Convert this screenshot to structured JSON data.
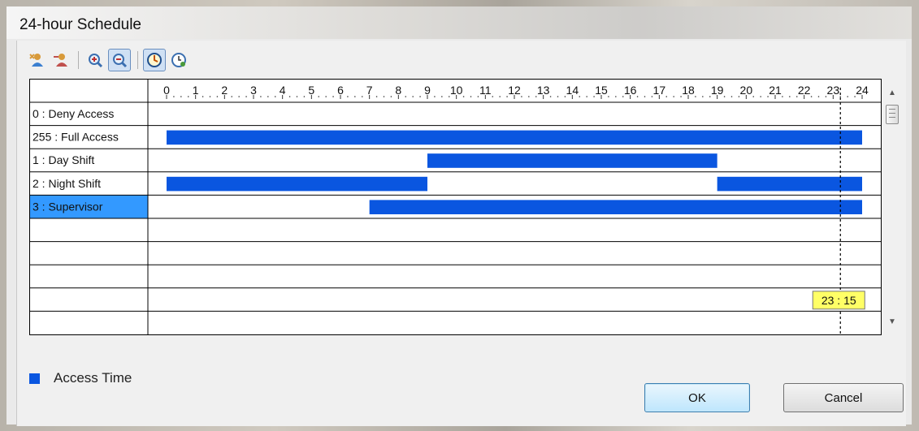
{
  "window": {
    "title": "24-hour Schedule"
  },
  "toolbar": {
    "buttons": [
      {
        "icon": "add-user-icon"
      },
      {
        "icon": "remove-user-icon"
      },
      {
        "icon": "zoom-in-icon"
      },
      {
        "icon": "zoom-out-icon",
        "active": true
      },
      {
        "icon": "clock-icon",
        "active": true
      },
      {
        "icon": "clock-settings-icon"
      }
    ]
  },
  "timeline": {
    "hours": [
      "0",
      "1",
      "2",
      "3",
      "4",
      "5",
      "6",
      "7",
      "8",
      "9",
      "10",
      "11",
      "12",
      "13",
      "14",
      "15",
      "16",
      "17",
      "18",
      "19",
      "20",
      "21",
      "22",
      "23",
      "24"
    ],
    "current_time_label": "23 : 15",
    "current_time_hours": 23.25
  },
  "rows": [
    {
      "label": "0 : Deny Access",
      "segments": []
    },
    {
      "label": "255 : Full Access",
      "segments": [
        [
          0,
          24
        ]
      ]
    },
    {
      "label": "1 : Day Shift",
      "segments": [
        [
          9,
          19
        ]
      ]
    },
    {
      "label": "2 : Night Shift",
      "segments": [
        [
          0,
          9
        ],
        [
          19,
          24
        ]
      ]
    },
    {
      "label": "3 : Supervisor",
      "segments": [
        [
          7,
          24
        ]
      ],
      "selected": true
    },
    {
      "label": "",
      "segments": []
    },
    {
      "label": "",
      "segments": []
    },
    {
      "label": "",
      "segments": []
    },
    {
      "label": "",
      "segments": []
    },
    {
      "label": "",
      "segments": []
    }
  ],
  "legend": {
    "label": "Access Time",
    "color": "#0a56e0"
  },
  "buttons": {
    "ok": "OK",
    "cancel": "Cancel"
  },
  "colors": {
    "bar": "#0a56e0",
    "selection": "#3399ff",
    "time_badge": "#ffff66"
  }
}
